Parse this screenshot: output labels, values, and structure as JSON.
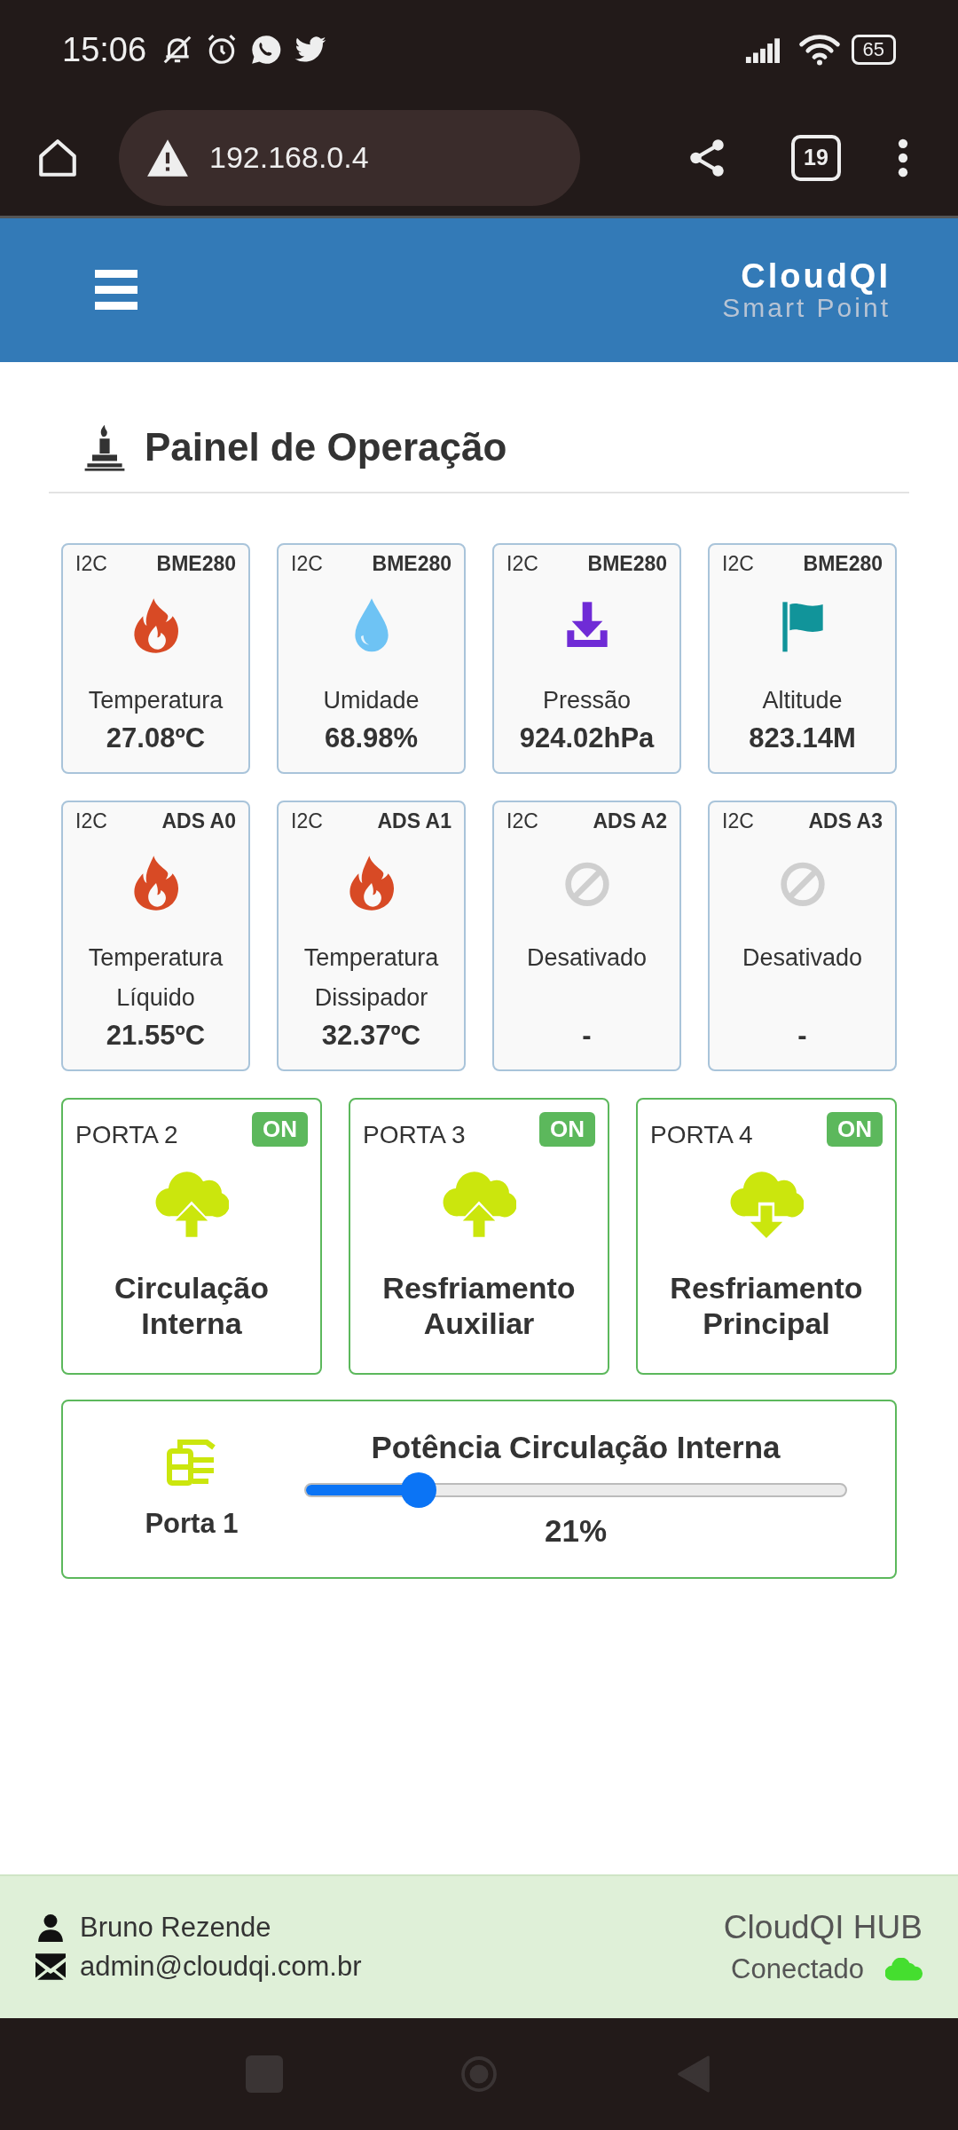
{
  "status_bar": {
    "time": "15:06",
    "battery": "65"
  },
  "browser": {
    "url": "192.168.0.4",
    "tab_count": "19"
  },
  "header": {
    "brand": "CloudQI",
    "tagline": "Smart Point"
  },
  "page_title": "Painel de Operação",
  "sensors": [
    {
      "bus": "I2C",
      "device": "BME280",
      "kind": "temperature",
      "label": "Temperatura",
      "value": "27.08ºC"
    },
    {
      "bus": "I2C",
      "device": "BME280",
      "kind": "humidity",
      "label": "Umidade",
      "value": "68.98%"
    },
    {
      "bus": "I2C",
      "device": "BME280",
      "kind": "pressure",
      "label": "Pressão",
      "value": "924.02hPa"
    },
    {
      "bus": "I2C",
      "device": "BME280",
      "kind": "altitude",
      "label": "Altitude",
      "value": "823.14M"
    },
    {
      "bus": "I2C",
      "device": "ADS A0",
      "kind": "temperature",
      "label": "Temperatura Líquido",
      "value": "21.55ºC"
    },
    {
      "bus": "I2C",
      "device": "ADS A1",
      "kind": "temperature",
      "label": "Temperatura Dissipador",
      "value": "32.37ºC"
    },
    {
      "bus": "I2C",
      "device": "ADS A2",
      "kind": "disabled",
      "label": "Desativado",
      "value": "-"
    },
    {
      "bus": "I2C",
      "device": "ADS A3",
      "kind": "disabled",
      "label": "Desativado",
      "value": "-"
    }
  ],
  "ports": [
    {
      "port": "PORTA 2",
      "badge": "ON",
      "on": true,
      "kind": "up",
      "name": "Circulação Interna"
    },
    {
      "port": "PORTA 3",
      "badge": "ON",
      "on": true,
      "kind": "up",
      "name": "Resfriamento Auxiliar"
    },
    {
      "port": "PORTA 4",
      "badge": "ON",
      "on": true,
      "kind": "down",
      "name": "Resfriamento Principal"
    }
  ],
  "dimmer": {
    "port": "Porta 1",
    "title": "Potência Circulação Interna",
    "level": 0.21,
    "reading": "21%"
  },
  "footer": {
    "user": "Bruno Rezende",
    "email": "admin@cloudqi.com.br",
    "hub": "CloudQI HUB",
    "status": "Conectado",
    "connected": true
  }
}
